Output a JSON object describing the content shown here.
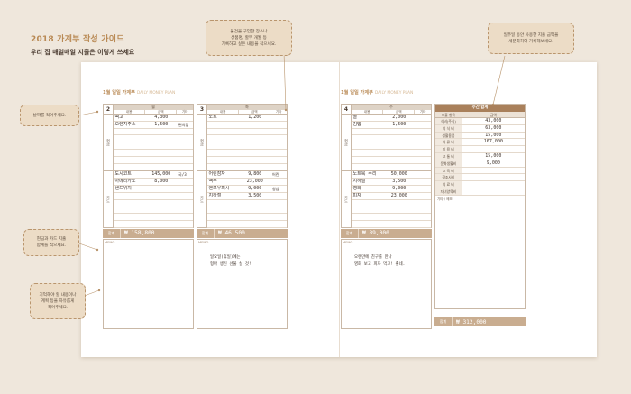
{
  "header": {
    "title": "2018 가계부 작성 가이드",
    "subtitle": "우리 집 매일매일 지출은 이렇게 쓰세요"
  },
  "left_page": {
    "title": "1월 일일 가계부",
    "title_sub": "DAILY MONEY PLAN",
    "days": [
      {
        "num": "2",
        "weekday": "월",
        "cols": [
          "내용",
          "금액",
          "기타"
        ],
        "cash_label": "현금",
        "card_label": "카드",
        "cash_rows": [
          [
            "떡고",
            "4,300",
            ""
          ],
          [
            "오렌지주스",
            "1,500",
            "편의점"
          ],
          [
            "",
            "",
            ""
          ],
          [
            "",
            "",
            ""
          ],
          [
            "",
            "",
            ""
          ],
          [
            "",
            "",
            ""
          ],
          [
            "",
            "",
            ""
          ],
          [
            "",
            "",
            ""
          ]
        ],
        "card_rows": [
          [
            "도시코트",
            "145,000",
            "국/3"
          ],
          [
            "아메리카노",
            "8,000",
            ""
          ],
          [
            "샌드위치",
            "",
            ""
          ],
          [
            "",
            "",
            ""
          ],
          [
            "",
            "",
            ""
          ],
          [
            "",
            "",
            ""
          ],
          [
            "",
            "",
            ""
          ],
          [
            "",
            "",
            ""
          ]
        ],
        "total_label": "합계",
        "total": "₩ 158,800",
        "memo_label": "MEMO",
        "memo": ""
      },
      {
        "num": "3",
        "weekday": "화",
        "cols": [
          "내용",
          "금액",
          "기타"
        ],
        "cash_label": "현금",
        "card_label": "카드",
        "cash_rows": [
          [
            "노트",
            "1,200",
            ""
          ],
          [
            "",
            "",
            ""
          ],
          [
            "",
            "",
            ""
          ],
          [
            "",
            "",
            ""
          ],
          [
            "",
            "",
            ""
          ],
          [
            "",
            "",
            ""
          ],
          [
            "",
            "",
            ""
          ],
          [
            "",
            "",
            ""
          ]
        ],
        "card_rows": [
          [
            "어린잠자",
            "9,800",
            "어린"
          ],
          [
            "액주",
            "23,000",
            ""
          ],
          [
            "엔보우피시",
            "9,000",
            "형삼"
          ],
          [
            "지하철",
            "3,500",
            ""
          ],
          [
            "",
            "",
            ""
          ],
          [
            "",
            "",
            ""
          ],
          [
            "",
            "",
            ""
          ],
          [
            "",
            "",
            ""
          ]
        ],
        "total_label": "합계",
        "total": "₩ 46,500",
        "memo_label": "MEMO",
        "memo": "일요일(휴일)에는\n형마 생신 선물 살 것!"
      }
    ]
  },
  "right_page": {
    "title": "1월 일일 가계부",
    "title_sub": "DAILY MONEY PLAN",
    "day": {
      "num": "4",
      "weekday": "수",
      "cols": [
        "내용",
        "금액",
        "기타"
      ],
      "cash_label": "현금",
      "card_label": "카드",
      "cash_rows": [
        [
          "쌀",
          "2,000",
          ""
        ],
        [
          "김밥",
          "1,500",
          ""
        ],
        [
          "",
          "",
          ""
        ],
        [
          "",
          "",
          ""
        ],
        [
          "",
          "",
          ""
        ],
        [
          "",
          "",
          ""
        ],
        [
          "",
          "",
          ""
        ],
        [
          "",
          "",
          ""
        ]
      ],
      "card_rows": [
        [
          "노트북 수리",
          "50,000",
          ""
        ],
        [
          "지하철",
          "3,500",
          ""
        ],
        [
          "영화",
          "9,000",
          ""
        ],
        [
          "피자",
          "23,000",
          ""
        ],
        [
          "",
          "",
          ""
        ],
        [
          "",
          "",
          ""
        ],
        [
          "",
          "",
          ""
        ],
        [
          "",
          "",
          ""
        ]
      ],
      "total_label": "합계",
      "total": "₩ 89,000",
      "memo_label": "MEMO",
      "memo": "오랜만에 친구를 만나\n영화 보고 피자 먹고! 좋네."
    },
    "weekly": {
      "title": "주간 합계",
      "cols": [
        "지출 항목",
        "금액"
      ],
      "rows": [
        [
          "식비(주식)",
          "43,000"
        ],
        [
          "외 식 비",
          "63,000"
        ],
        [
          "생활용품",
          "15,000"
        ],
        [
          "의 류 비",
          "167,000"
        ],
        [
          "미 용 비",
          ""
        ],
        [
          "교 통 비",
          "15,000"
        ],
        [
          "문화생활비",
          "9,000"
        ],
        [
          "교 육 비",
          ""
        ],
        [
          "경조사비",
          ""
        ],
        [
          "의 료 비",
          ""
        ],
        [
          "자녀양육비",
          ""
        ]
      ],
      "other_label": "기타 / 메모",
      "total_label": "합계",
      "total": "₩ 312,000"
    }
  },
  "callouts": {
    "date": "날짜를 적어주세요.",
    "content": "물건을 구입한 장소나\n상품명, 할부 개월 등\n기록하고 싶은 내용을 적으세요.",
    "cash_card": "현금과 카드 지출\n합계를 적으세요.",
    "memo": "기억해야 할 내용이나\n계획 등을 자유롭게\n적어주세요.",
    "weekly": "일주일 동안 사용한 지출 금액을\n세분화하여 기록해보세요."
  }
}
